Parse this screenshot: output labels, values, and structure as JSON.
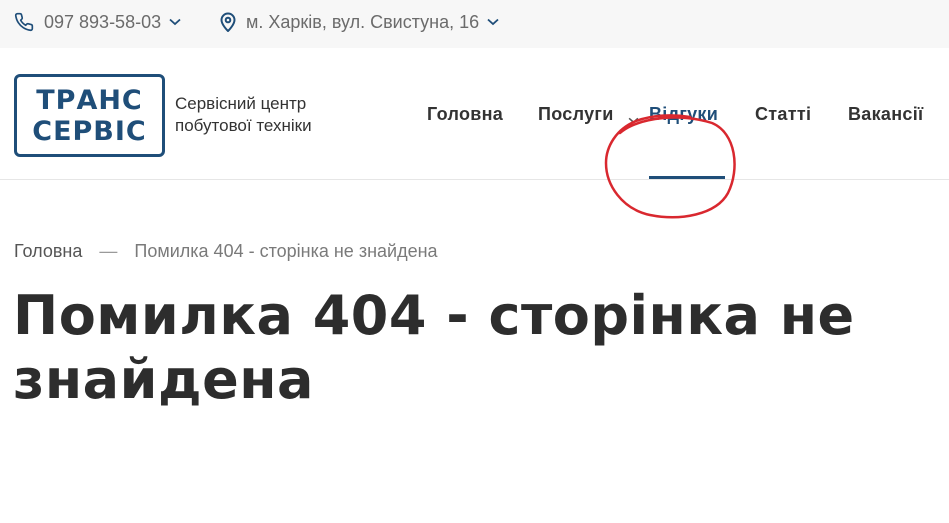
{
  "topbar": {
    "phone": "097 893-58-03",
    "address": "м. Харків, вул. Свистуна, 16"
  },
  "logo": {
    "line1": "ТРАНС",
    "line2": "СЕРВІС"
  },
  "tagline": {
    "line1": "Сервісний центр",
    "line2": "побутової техніки"
  },
  "nav": {
    "home": "Головна",
    "services": "Послуги",
    "reviews": "Відгуки",
    "articles": "Статті",
    "jobs": "Вакансії",
    "active": "reviews"
  },
  "breadcrumb": {
    "home": "Головна",
    "separator": "—",
    "current": "Помилка 404 - сторінка не знайдена"
  },
  "page": {
    "title": "Помилка 404 - сторінка не знайдена"
  },
  "colors": {
    "brand": "#1f4e79",
    "annotation": "#d9282f",
    "topbar_bg": "#f7f7f7"
  },
  "icons": {
    "phone": "phone-icon",
    "location": "location-pin-icon",
    "dropdown": "chevron-down-icon"
  }
}
